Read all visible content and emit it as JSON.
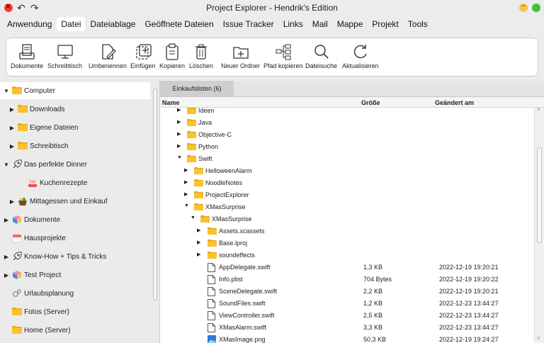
{
  "window": {
    "title": "Project Explorer - Hendrik's Edition",
    "undo_icon": "undo-icon",
    "redo_icon": "redo-icon"
  },
  "menu": [
    "Anwendung",
    "Datei",
    "Dateiablage",
    "Geöffnete Dateien",
    "Issue Tracker",
    "Links",
    "Mail",
    "Mappe",
    "Projekt",
    "Tools"
  ],
  "toolbar": [
    {
      "label": "Dokumente",
      "icon": "documents-icon"
    },
    {
      "label": "Schreibtisch",
      "icon": "desktop-icon"
    },
    {
      "label": "Umbenennen",
      "icon": "rename-icon"
    },
    {
      "label": "Einfügen",
      "icon": "paste-icon"
    },
    {
      "label": "Kopieren",
      "icon": "copy-icon"
    },
    {
      "label": "Löschen",
      "icon": "trash-icon"
    },
    {
      "label": "Neuer Ordner",
      "icon": "new-folder-icon"
    },
    {
      "label": "Pfad kopieren",
      "icon": "copy-path-icon"
    },
    {
      "label": "Dateisuche",
      "icon": "search-icon"
    },
    {
      "label": "Aktualisieren",
      "icon": "refresh-icon"
    }
  ],
  "sidebar": [
    {
      "label": "Computer",
      "icon": "folder-icon",
      "expanded": true,
      "selected": true
    },
    {
      "label": "Downloads",
      "icon": "folder-icon"
    },
    {
      "label": "Eigene Dateien",
      "icon": "folder-icon"
    },
    {
      "label": "Schreibtisch",
      "icon": "folder-icon"
    },
    {
      "label": "Das perfekte Dinner",
      "icon": "rocket-icon",
      "expanded": true
    },
    {
      "label": "Kuchenrezepte",
      "icon": "cake-icon"
    },
    {
      "label": "Mittagessen und Einkauf",
      "icon": "basket-icon"
    },
    {
      "label": "Dokumente",
      "icon": "cube-icon"
    },
    {
      "label": "Hausprojekte",
      "icon": "calendar-icon"
    },
    {
      "label": "Know-How + Tips & Tricks",
      "icon": "rocket-icon"
    },
    {
      "label": "Test Project",
      "icon": "cube-icon"
    },
    {
      "label": "Urlaubsplanung",
      "icon": "gears-icon"
    },
    {
      "label": "Fotos (Server)",
      "icon": "folder-icon"
    },
    {
      "label": "Home (Server)",
      "icon": "folder-icon"
    }
  ],
  "tab": {
    "label": "Einkaufslisten (6)"
  },
  "columns": {
    "name": "Name",
    "size": "Größe",
    "date": "Geändert am"
  },
  "rows": [
    {
      "name": "Ideen",
      "type": "folder",
      "depth": 0,
      "tri": "▶",
      "size": "",
      "date": ""
    },
    {
      "name": "Java",
      "type": "folder",
      "depth": 0,
      "tri": "▶",
      "size": "",
      "date": ""
    },
    {
      "name": "Objective-C",
      "type": "folder",
      "depth": 0,
      "tri": "▶",
      "size": "",
      "date": ""
    },
    {
      "name": "Python",
      "type": "folder",
      "depth": 0,
      "tri": "▶",
      "size": "",
      "date": ""
    },
    {
      "name": "Swift",
      "type": "folder",
      "depth": 0,
      "tri": "▼",
      "size": "",
      "date": ""
    },
    {
      "name": "HelloweenAlarm",
      "type": "folder",
      "depth": 1,
      "tri": "▶",
      "size": "",
      "date": ""
    },
    {
      "name": "NoodleNotes",
      "type": "folder",
      "depth": 1,
      "tri": "▶",
      "size": "",
      "date": ""
    },
    {
      "name": "ProjectExplorer",
      "type": "folder",
      "depth": 1,
      "tri": "▶",
      "size": "",
      "date": ""
    },
    {
      "name": "XMasSurprise",
      "type": "folder",
      "depth": 1,
      "tri": "▼",
      "size": "",
      "date": ""
    },
    {
      "name": "XMasSurprise",
      "type": "folder",
      "depth": 2,
      "tri": "▼",
      "size": "",
      "date": ""
    },
    {
      "name": "Assets.xcassets",
      "type": "folder",
      "depth": 3,
      "tri": "▶",
      "size": "",
      "date": ""
    },
    {
      "name": "Base.lproj",
      "type": "folder",
      "depth": 3,
      "tri": "▶",
      "size": "",
      "date": ""
    },
    {
      "name": "soundeffects",
      "type": "folder",
      "depth": 3,
      "tri": "▶",
      "size": "",
      "date": ""
    },
    {
      "name": "AppDelegate.swift",
      "type": "file",
      "depth": 3,
      "tri": "",
      "size": "1,3 KB",
      "date": "2022-12-19 19:20:21"
    },
    {
      "name": "Info.plist",
      "type": "file",
      "depth": 3,
      "tri": "",
      "size": "704 Bytes",
      "date": "2022-12-19 19:20:22"
    },
    {
      "name": "SceneDelegate.swift",
      "type": "file",
      "depth": 3,
      "tri": "",
      "size": "2,2 KB",
      "date": "2022-12-19 19:20:21"
    },
    {
      "name": "SoundFiles.swift",
      "type": "file",
      "depth": 3,
      "tri": "",
      "size": "1,2 KB",
      "date": "2022-12-23 13:44:27"
    },
    {
      "name": "ViewController.swift",
      "type": "file",
      "depth": 3,
      "tri": "",
      "size": "2,5 KB",
      "date": "2022-12-23 13:44:27"
    },
    {
      "name": "XMasAlarm.swift",
      "type": "file",
      "depth": 3,
      "tri": "",
      "size": "3,3 KB",
      "date": "2022-12-23 13:44:27"
    },
    {
      "name": "XMasImage.png",
      "type": "image",
      "depth": 3,
      "tri": "",
      "size": "50,3 KB",
      "date": "2022-12-19 19:24:27"
    }
  ],
  "colors": {
    "folder": "#f9c22e",
    "folder_dark": "#e8a817",
    "selection": "#ffffff",
    "close": "#fc3b3b",
    "minimize": "#f6c344",
    "maximize": "#3fc23a"
  }
}
